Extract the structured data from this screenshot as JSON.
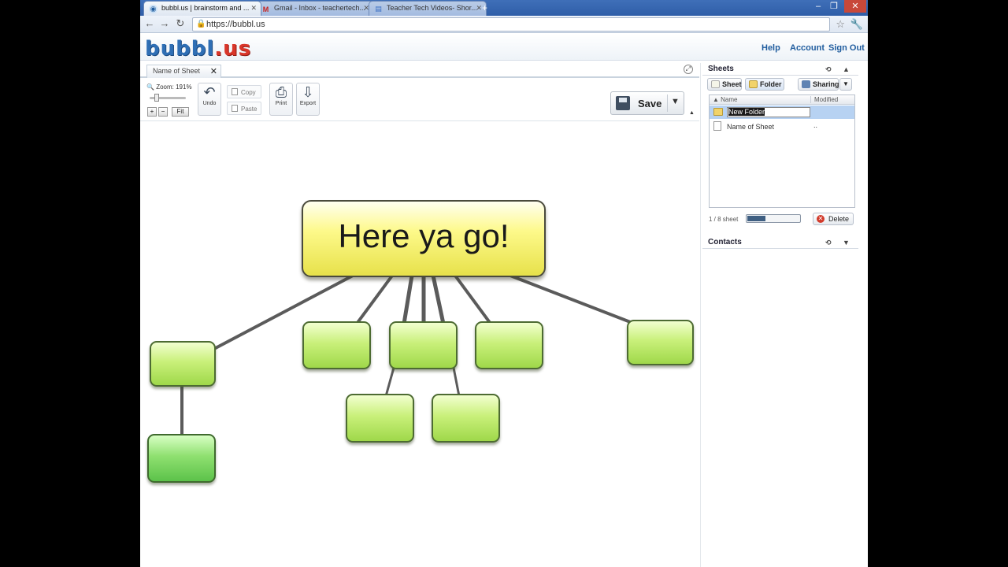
{
  "browser": {
    "tabs": [
      {
        "title": "bubbl.us | brainstorm and ...",
        "favicon": "bubbl-favicon-icon",
        "active": true
      },
      {
        "title": "Gmail - Inbox - teachertech...",
        "favicon": "gmail-icon",
        "active": false
      },
      {
        "title": "Teacher Tech Videos- Shor...",
        "favicon": "docs-icon",
        "active": false
      }
    ],
    "new_tab": "+",
    "url": "https://bubbl.us"
  },
  "app": {
    "logo_left": "bubbl",
    "logo_right": ".us",
    "nav": {
      "help": "Help",
      "account": "Account",
      "sign_out": "Sign Out"
    }
  },
  "editor": {
    "sheet_tab_label": "Name of Sheet",
    "zoom_label": "Zoom:",
    "zoom_value": "191%",
    "zoom_in": "+",
    "zoom_out": "−",
    "fit": "Fit",
    "undo": "Undo",
    "copy": "Copy",
    "paste": "Paste",
    "print": "Print",
    "export": "Export",
    "save": "Save"
  },
  "mindmap": {
    "root_text": "Here ya go!",
    "child_count": 9
  },
  "sheets_panel": {
    "title": "Sheets",
    "buttons": {
      "sheet": "Sheet",
      "folder": "Folder",
      "sharing": "Sharing"
    },
    "columns": {
      "name": "Name",
      "modified": "Modified"
    },
    "rows": [
      {
        "name": "New Folder",
        "modified": "",
        "type": "folder",
        "editing": true
      },
      {
        "name": "Name of Sheet",
        "modified": "..",
        "type": "sheet",
        "editing": false
      }
    ],
    "count": "1 / 8 sheet",
    "usage_fraction": 0.35,
    "delete": "Delete"
  },
  "contacts_panel": {
    "title": "Contacts"
  },
  "colors": {
    "root_fill": "#fdf98a",
    "child_fill": "#c9f07a",
    "child_dark_fill": "#8fe070",
    "link": "#1f5c9e",
    "tab_strip": "#3f6fb8"
  }
}
